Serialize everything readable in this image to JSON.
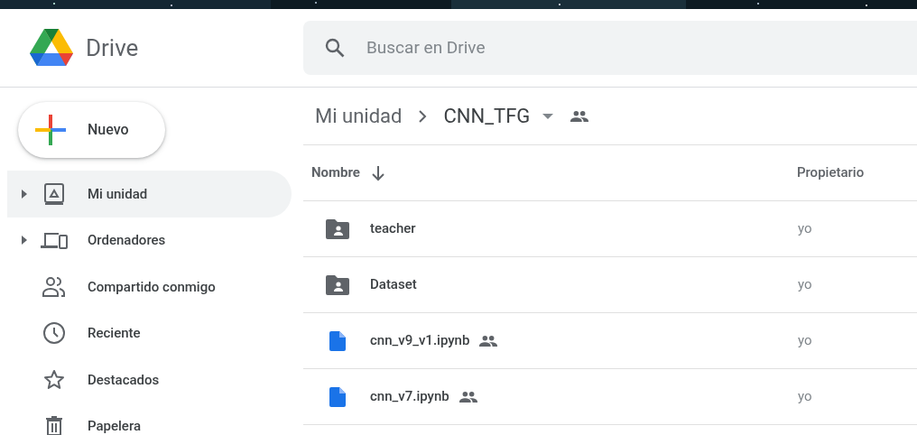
{
  "app": {
    "name": "Drive"
  },
  "search": {
    "placeholder": "Buscar en Drive"
  },
  "new_button": {
    "label": "Nuevo"
  },
  "sidebar": {
    "items": [
      {
        "label": "Mi unidad",
        "selected": true,
        "expandable": true
      },
      {
        "label": "Ordenadores",
        "selected": false,
        "expandable": true
      },
      {
        "label": "Compartido conmigo",
        "selected": false,
        "expandable": false
      },
      {
        "label": "Reciente",
        "selected": false,
        "expandable": false
      },
      {
        "label": "Destacados",
        "selected": false,
        "expandable": false
      },
      {
        "label": "Papelera",
        "selected": false,
        "expandable": false
      }
    ]
  },
  "breadcrumb": {
    "items": [
      "Mi unidad",
      "CNN_TFG"
    ],
    "shared": true
  },
  "table": {
    "columns": [
      "Nombre",
      "Propietario"
    ],
    "rows": [
      {
        "kind": "folder",
        "name": "teacher",
        "shared": false,
        "owner": "yo"
      },
      {
        "kind": "folder",
        "name": "Dataset",
        "shared": false,
        "owner": "yo"
      },
      {
        "kind": "file",
        "name": "cnn_v9_v1.ipynb",
        "shared": true,
        "owner": "yo"
      },
      {
        "kind": "file",
        "name": "cnn_v7.ipynb",
        "shared": true,
        "owner": "yo"
      }
    ]
  }
}
